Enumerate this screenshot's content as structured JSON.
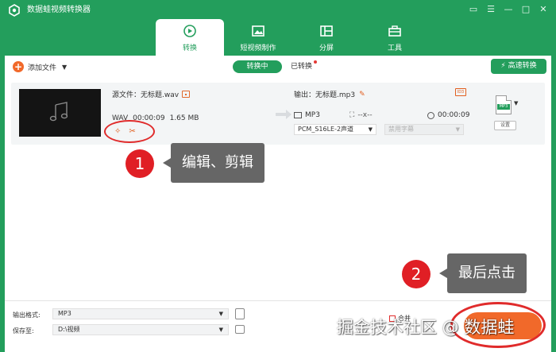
{
  "app": {
    "title": "数据蛙视频转换器"
  },
  "window_controls": [
    "▭",
    "☰",
    "—",
    "□",
    "✕"
  ],
  "tabs": [
    {
      "label": "转换",
      "icon": "convert-icon",
      "active": true
    },
    {
      "label": "短视频制作",
      "icon": "short-video-icon",
      "active": false
    },
    {
      "label": "分屏",
      "icon": "split-screen-icon",
      "active": false
    },
    {
      "label": "工具",
      "icon": "toolbox-icon",
      "active": false
    }
  ],
  "toolbar": {
    "add_file": "添加文件",
    "converting": "转换中",
    "converted": "已转换",
    "fast_convert": "高速转换"
  },
  "file": {
    "source_label": "源文件：无标题.wav",
    "format": "WAV",
    "duration": "00:00:09",
    "size": "1.65 MB",
    "output_label": "输出：无标题.mp3",
    "output_format": "MP3",
    "resolution": "--x--",
    "output_duration": "00:00:09",
    "audio_track": "PCM_S16LE-2声道",
    "subtitle": "禁用字幕",
    "format_badge": "MP3",
    "settings": "设置",
    "id3": "ID3"
  },
  "annotations": {
    "badge1": "1",
    "callout1": "编辑、剪辑",
    "badge2": "2",
    "callout2": "最后点击"
  },
  "bottom": {
    "output_format_label": "输出格式:",
    "output_format_value": "MP3",
    "save_to_label": "保存至:",
    "save_to_value": "D:\\视频",
    "merge_label": "合并"
  },
  "watermark": "掘金技术社区 @ 数据蛙",
  "colors": {
    "brand": "#239e5c",
    "accent": "#f1692a",
    "annotation": "#e01f25"
  }
}
